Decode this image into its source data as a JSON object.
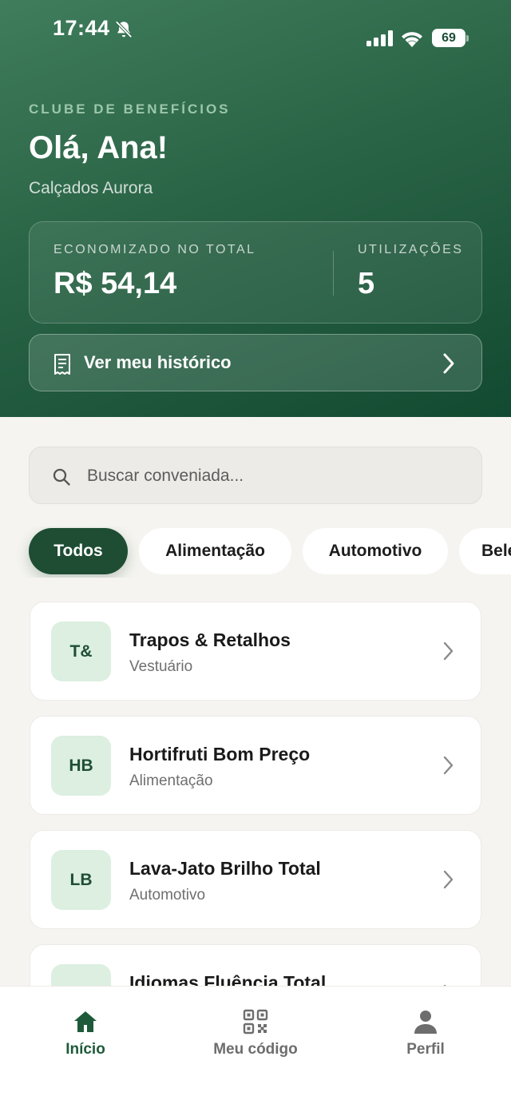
{
  "status_bar": {
    "time": "17:44",
    "battery": "69",
    "icons": [
      "bell-slash-icon",
      "cellular-signal-icon",
      "wifi-icon",
      "battery-icon"
    ]
  },
  "header": {
    "club_label": "CLUBE DE BENEFÍCIOS",
    "greeting": "Olá, Ana!",
    "company": "Calçados Aurora",
    "stats": {
      "saved_label": "ECONOMIZADO NO TOTAL",
      "saved_value": "R$ 54,14",
      "uses_label": "UTILIZAÇÕES",
      "uses_value": "5"
    },
    "history_button": "Ver meu histórico"
  },
  "search": {
    "placeholder": "Buscar conveniada..."
  },
  "categories": [
    {
      "label": "Todos",
      "active": true
    },
    {
      "label": "Alimentação",
      "active": false
    },
    {
      "label": "Automotivo",
      "active": false
    },
    {
      "label": "Bele",
      "active": false
    }
  ],
  "partners": [
    {
      "initials": "T&",
      "name": "Trapos & Retalhos",
      "category": "Vestuário"
    },
    {
      "initials": "HB",
      "name": "Hortifruti Bom Preço",
      "category": "Alimentação"
    },
    {
      "initials": "LB",
      "name": "Lava-Jato Brilho Total",
      "category": "Automotivo"
    },
    {
      "initials": "",
      "name": "Idiomas Fluência Total",
      "category": ""
    }
  ],
  "tabbar": [
    {
      "label": "Início",
      "icon": "home-icon",
      "active": true
    },
    {
      "label": "Meu código",
      "icon": "qr-code-icon",
      "active": false
    },
    {
      "label": "Perfil",
      "icon": "user-icon",
      "active": false
    }
  ],
  "colors": {
    "brand_dark": "#1e4d33",
    "header_gradient_start": "#3f7d5c",
    "header_gradient_end": "#124a31",
    "avatar_bg": "#dcefe0",
    "background": "#f5f4f0"
  }
}
